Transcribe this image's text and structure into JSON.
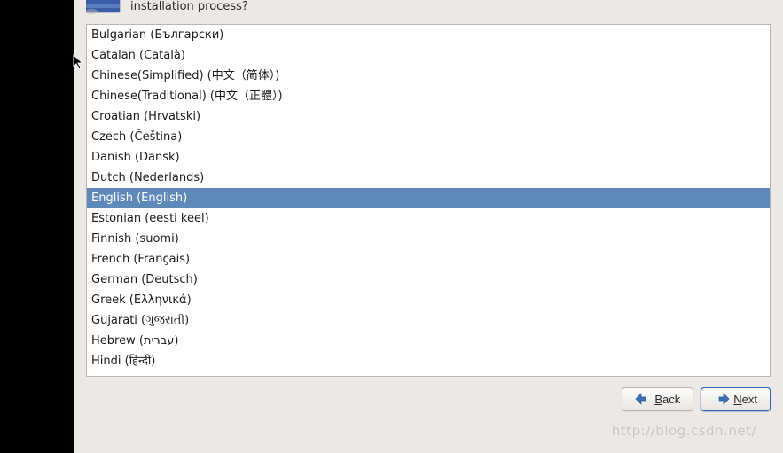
{
  "header": {
    "prompt": "installation process?"
  },
  "languages": {
    "items": [
      {
        "label": "Bulgarian (Български)"
      },
      {
        "label": "Catalan (Català)"
      },
      {
        "label": "Chinese(Simplified) (中文（简体）)"
      },
      {
        "label": "Chinese(Traditional) (中文（正體）)"
      },
      {
        "label": "Croatian (Hrvatski)"
      },
      {
        "label": "Czech (Čeština)"
      },
      {
        "label": "Danish (Dansk)"
      },
      {
        "label": "Dutch (Nederlands)"
      },
      {
        "label": "English (English)",
        "selected": true
      },
      {
        "label": "Estonian (eesti keel)"
      },
      {
        "label": "Finnish (suomi)"
      },
      {
        "label": "French (Français)"
      },
      {
        "label": "German (Deutsch)"
      },
      {
        "label": "Greek (Ελληνικά)"
      },
      {
        "label": "Gujarati (ગુજરાતી)"
      },
      {
        "label": "Hebrew (עברית)"
      },
      {
        "label": "Hindi (हिन्दी)"
      }
    ]
  },
  "buttons": {
    "back": "Back",
    "next": "Next"
  },
  "watermark": "http://blog.csdn.net/"
}
